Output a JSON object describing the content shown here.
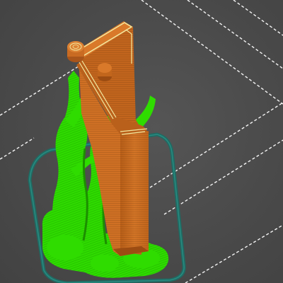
{
  "viewport": {
    "kind": "3d-slicer-preview",
    "background_color": "#4a4a4a",
    "grid_line_color": "#ffffff",
    "grid_line_style": "dashed"
  },
  "colors": {
    "support_material": "#2fdc00",
    "support_shadow": "#1c8f00",
    "model_wall": "#c86a1e",
    "model_wall_light": "#dd8233",
    "model_wall_dark": "#9c4c12",
    "model_infill_line": "#f2e8a0",
    "brim_skirt": "#1f6b63"
  },
  "legend_semantics": {
    "support_material": "support-structure",
    "model_wall": "printed-part",
    "brim_skirt": "skirt-outline"
  }
}
